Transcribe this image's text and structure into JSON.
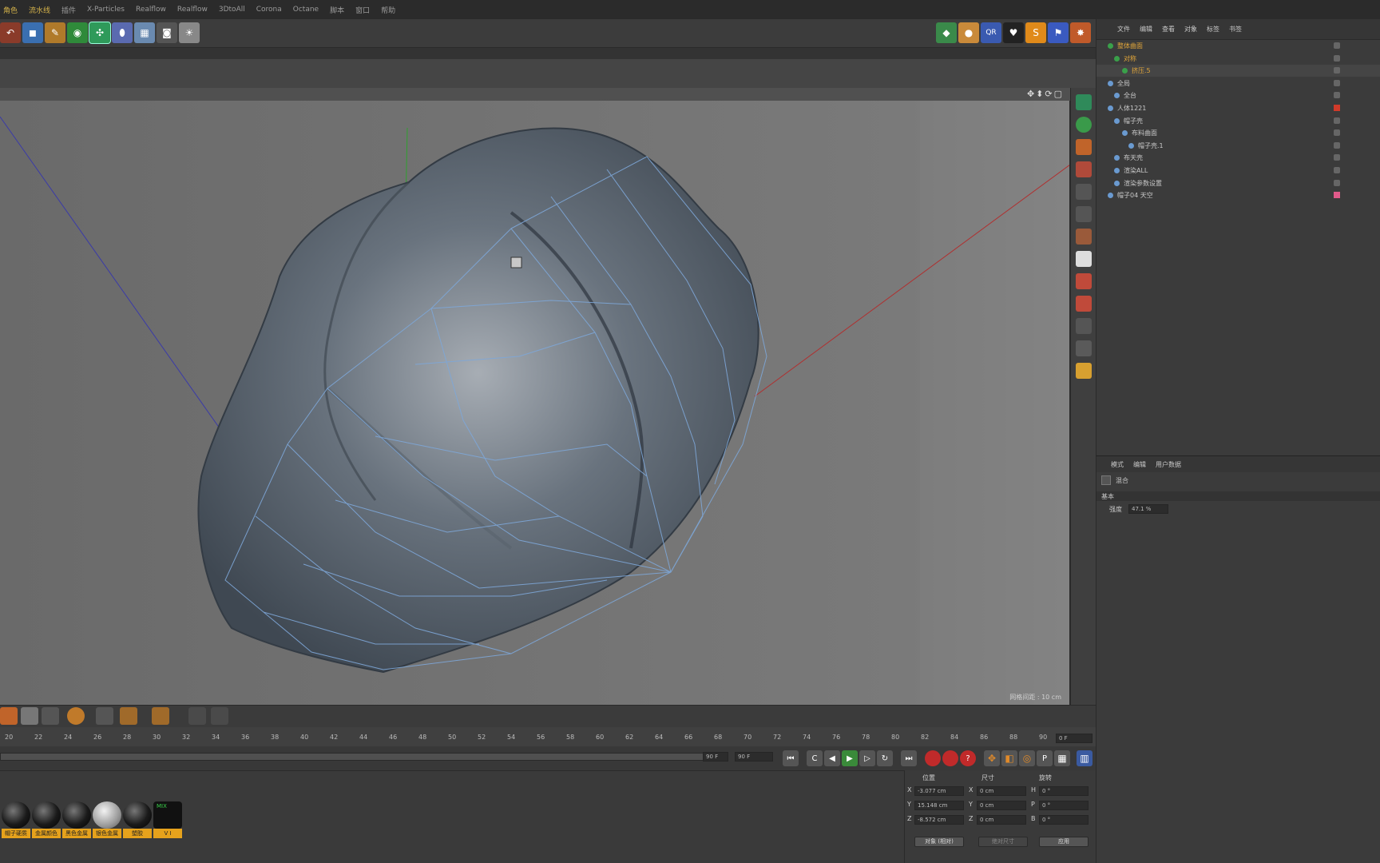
{
  "menu": {
    "items": [
      "角色",
      "流水线",
      "插件",
      "X-Particles",
      "Realflow",
      "Realflow",
      "3DtoAll",
      "Corona",
      "Octane",
      "脚本",
      "窗口",
      "帮助"
    ]
  },
  "object_manager": {
    "tabs": [
      "文件",
      "编辑",
      "查看",
      "对象",
      "标签",
      "书签"
    ],
    "objects": [
      {
        "name": "整体曲面",
        "color": "#e0a53a"
      },
      {
        "name": "对称",
        "color": "#e0a53a"
      },
      {
        "name": "挤压.5",
        "color": "#e0a53a"
      },
      {
        "name": "全局",
        "color": "#c8c8c8"
      },
      {
        "name": "全台",
        "color": "#c8c8c8"
      },
      {
        "name": "人体1221",
        "color": "#c8c8c8"
      },
      {
        "name": "帽子壳",
        "color": "#c8c8c8"
      },
      {
        "name": "布料曲面",
        "color": "#c8c8c8"
      },
      {
        "name": "帽子壳.1",
        "color": "#c8c8c8"
      },
      {
        "name": "布天壳",
        "color": "#c8c8c8"
      },
      {
        "name": "渲染ALL",
        "color": "#c8c8c8"
      },
      {
        "name": "渲染参数设置",
        "color": "#c8c8c8"
      },
      {
        "name": "帽子04 天空",
        "color": "#c8c8c8"
      }
    ]
  },
  "attributes": {
    "tabs": [
      "模式",
      "编辑",
      "用户数据"
    ],
    "object_label": "混合",
    "section": "基本",
    "strength_label": "强度",
    "strength_value": "47.1 %"
  },
  "viewport": {
    "grid_spacing": "网格间距 : 10 cm"
  },
  "timeline": {
    "ticks": [
      "20",
      "22",
      "24",
      "26",
      "28",
      "30",
      "32",
      "34",
      "36",
      "38",
      "40",
      "42",
      "44",
      "46",
      "48",
      "50",
      "52",
      "54",
      "56",
      "58",
      "60",
      "62",
      "64",
      "66",
      "68",
      "70",
      "72",
      "74",
      "76",
      "78",
      "80",
      "82",
      "84",
      "86",
      "88",
      "90"
    ],
    "current_frame": "0 F",
    "end_frame": "90 F",
    "end_frame2": "90 F"
  },
  "materials": [
    {
      "label": "帽子硬质",
      "type": "dark"
    },
    {
      "label": "金属颜色",
      "type": "dark"
    },
    {
      "label": "黑色金属",
      "type": "dark"
    },
    {
      "label": "银色金属",
      "type": "silver"
    },
    {
      "label": "塑胶",
      "type": "dark"
    },
    {
      "label": "V I",
      "type": "mix",
      "badge": "MIX"
    }
  ],
  "coordinates": {
    "headers": [
      "位置",
      "尺寸",
      "旋转"
    ],
    "rows": [
      {
        "axis": "X",
        "pos": "-3.077 cm",
        "size": "0 cm",
        "rot_axis": "H",
        "rot": "0 °"
      },
      {
        "axis": "Y",
        "pos": "15.148 cm",
        "size": "0 cm",
        "rot_axis": "P",
        "rot": "0 °"
      },
      {
        "axis": "Z",
        "pos": "-8.572 cm",
        "size": "0 cm",
        "rot_axis": "B",
        "rot": "0 °"
      }
    ],
    "mode_select": "对象 (相对)",
    "size_select": "绝对尺寸",
    "apply": "应用"
  }
}
